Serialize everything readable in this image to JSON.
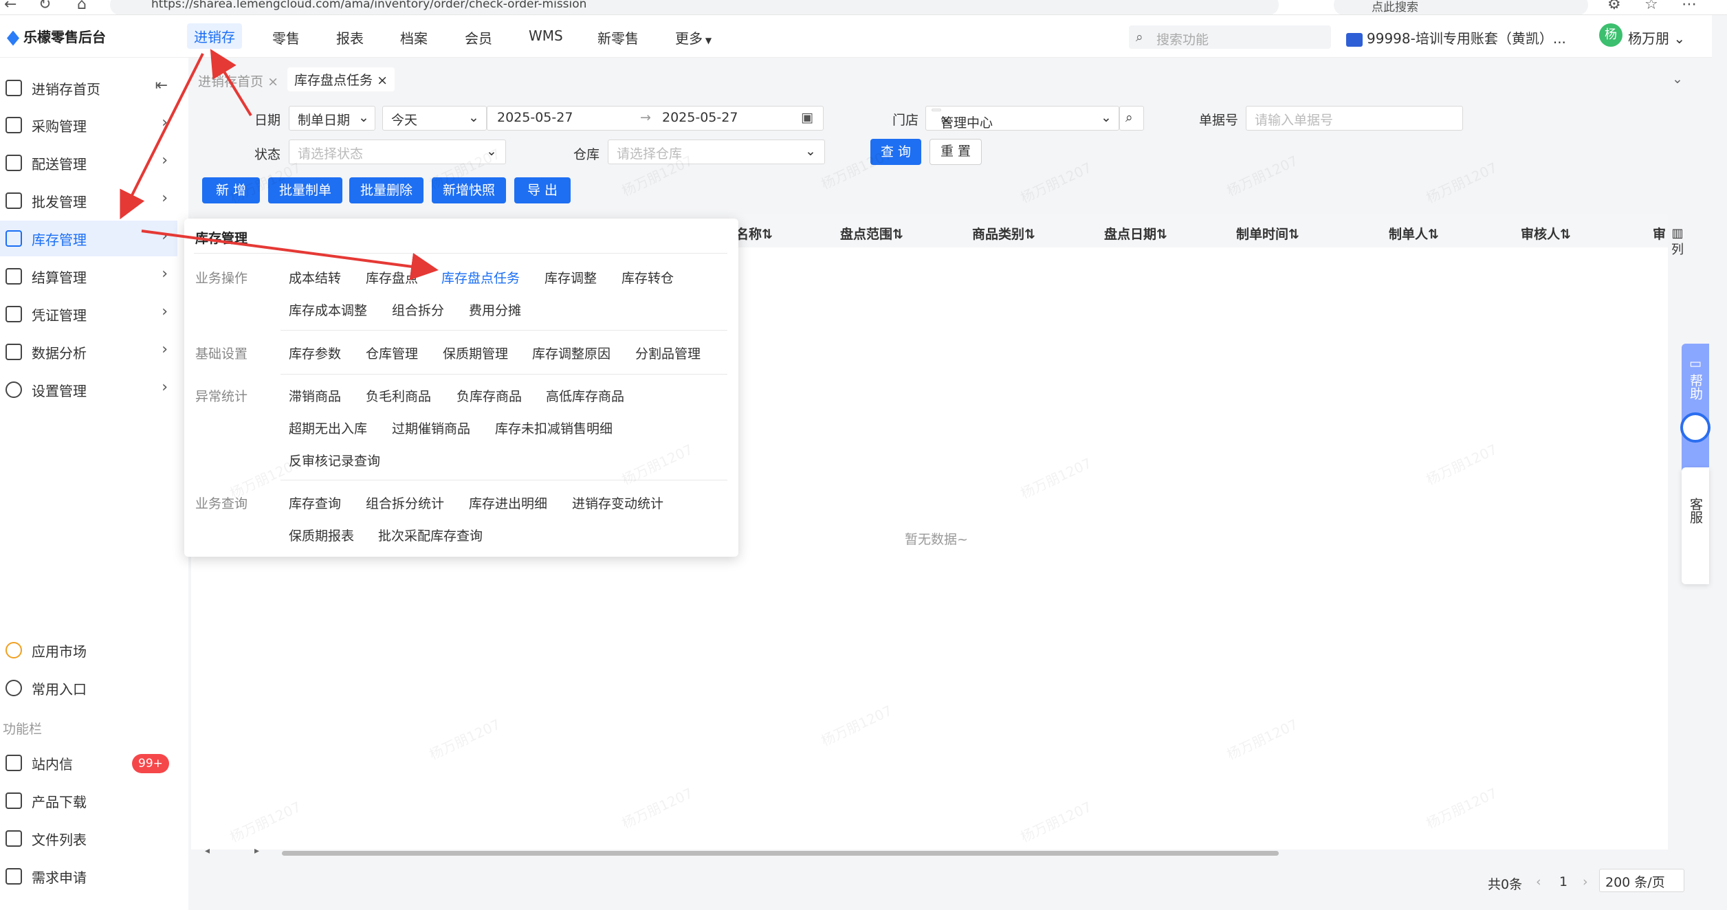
{
  "browser": {
    "url": "https://sharea.lemengcloud.com/ama/inventory/order/check-order-mission",
    "search_placeholder": "点此搜索"
  },
  "header": {
    "logo": "乐檬零售后台",
    "nav": [
      "进销存",
      "零售",
      "报表",
      "档案",
      "会员",
      "WMS",
      "新零售",
      "更多"
    ],
    "search_placeholder": "搜索功能",
    "account": "99998-培训专用账套（黄凯）...",
    "avatar_char": "杨",
    "user": "杨万朋"
  },
  "sidebar": {
    "items": [
      "进销存首页",
      "采购管理",
      "配送管理",
      "批发管理",
      "库存管理",
      "结算管理",
      "凭证管理",
      "数据分析",
      "设置管理"
    ],
    "bottom": [
      "应用市场",
      "常用入口"
    ],
    "section_label": "功能栏",
    "func": [
      "站内信",
      "产品下载",
      "文件列表",
      "需求申请"
    ],
    "badge": "99+"
  },
  "tabs": {
    "home": "进销存首页",
    "current": "库存盘点任务"
  },
  "filters": {
    "date_label": "日期",
    "date_type": "制单日期",
    "date_range": "今天",
    "date_start": "2025-05-27",
    "date_sep": "→",
    "date_end": "2025-05-27",
    "store_label": "门店",
    "store_value": "管理中心",
    "docno_label": "单据号",
    "docno_placeholder": "请输入单据号",
    "status_label": "状态",
    "status_placeholder": "请选择状态",
    "warehouse_label": "仓库",
    "warehouse_placeholder": "请选择仓库",
    "query": "查 询",
    "reset": "重 置"
  },
  "actions": [
    "新 增",
    "批量制单",
    "批量删除",
    "新增快照",
    "导 出"
  ],
  "table": {
    "columns": [
      "名称",
      "盘点范围",
      "商品类别",
      "盘点日期",
      "制单时间",
      "制单人",
      "审核人",
      "审"
    ],
    "column_settings": "列",
    "empty": "暂无数据~"
  },
  "pager": {
    "total": "共0条",
    "page": "1",
    "size": "200 条/页"
  },
  "popup": {
    "title": "库存管理",
    "groups": [
      {
        "label": "业务操作",
        "rows": [
          [
            "成本结转",
            "库存盘点",
            "库存盘点任务",
            "库存调整",
            "库存转仓"
          ],
          [
            "库存成本调整",
            "组合拆分",
            "费用分摊"
          ]
        ]
      },
      {
        "label": "基础设置",
        "rows": [
          [
            "库存参数",
            "仓库管理",
            "保质期管理",
            "库存调整原因",
            "分割品管理"
          ]
        ]
      },
      {
        "label": "异常统计",
        "rows": [
          [
            "滞销商品",
            "负毛利商品",
            "负库存商品",
            "高低库存商品"
          ],
          [
            "超期无出入库",
            "过期催销商品",
            "库存未扣减销售明细"
          ],
          [
            "反审核记录查询"
          ]
        ]
      },
      {
        "label": "业务查询",
        "rows": [
          [
            "库存查询",
            "组合拆分统计",
            "库存进出明细",
            "进销存变动统计"
          ],
          [
            "保质期报表",
            "批次采配库存查询"
          ]
        ]
      }
    ]
  },
  "right_panel": {
    "help": "帮助",
    "service": "客服"
  },
  "watermark": "杨万朋1207",
  "colors": {
    "primary": "#1e6ff2",
    "annotation_arrow": "#e53935"
  }
}
